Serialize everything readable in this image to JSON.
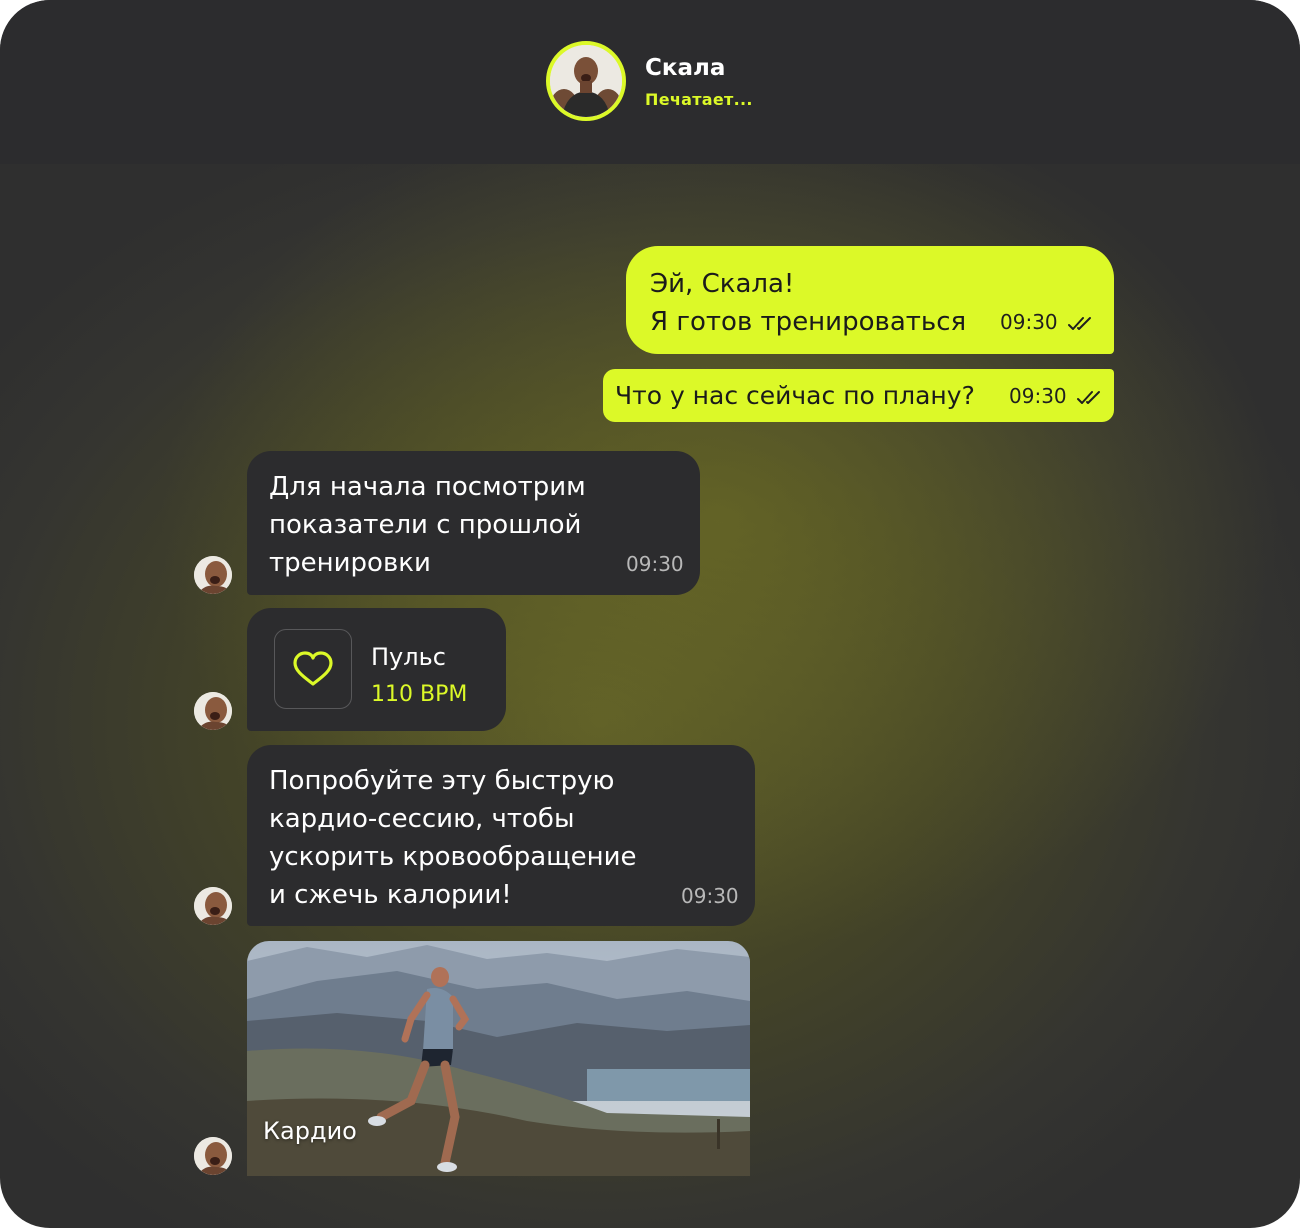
{
  "header": {
    "contact_name": "Скала",
    "status": "Печатает..."
  },
  "messages": {
    "out1": {
      "line1": "Эй, Скала!",
      "line2": "Я готов тренироваться",
      "time": "09:30"
    },
    "out2": {
      "text": "Что у нас сейчас по плану?",
      "time": "09:30"
    },
    "in1": {
      "line1": "Для начала посмотрим",
      "line2": "показатели с прошлой",
      "line3": "тренировки",
      "time": "09:30"
    },
    "pulse": {
      "title": "Пульс",
      "value": "110 BPM",
      "icon": "heart-icon"
    },
    "in2": {
      "line1": "Попробуйте эту быструю",
      "line2": "кардио-сессию, чтобы",
      "line3": "ускорить кровообращение",
      "line4": "и сжечь калории!",
      "time": "09:30"
    },
    "photo": {
      "caption": "Кардио"
    }
  },
  "colors": {
    "accent": "#dcf928",
    "header_bg": "#2c2c2e",
    "incoming_bubble": "#2c2c2e",
    "outgoing_bubble": "#dcf928"
  }
}
